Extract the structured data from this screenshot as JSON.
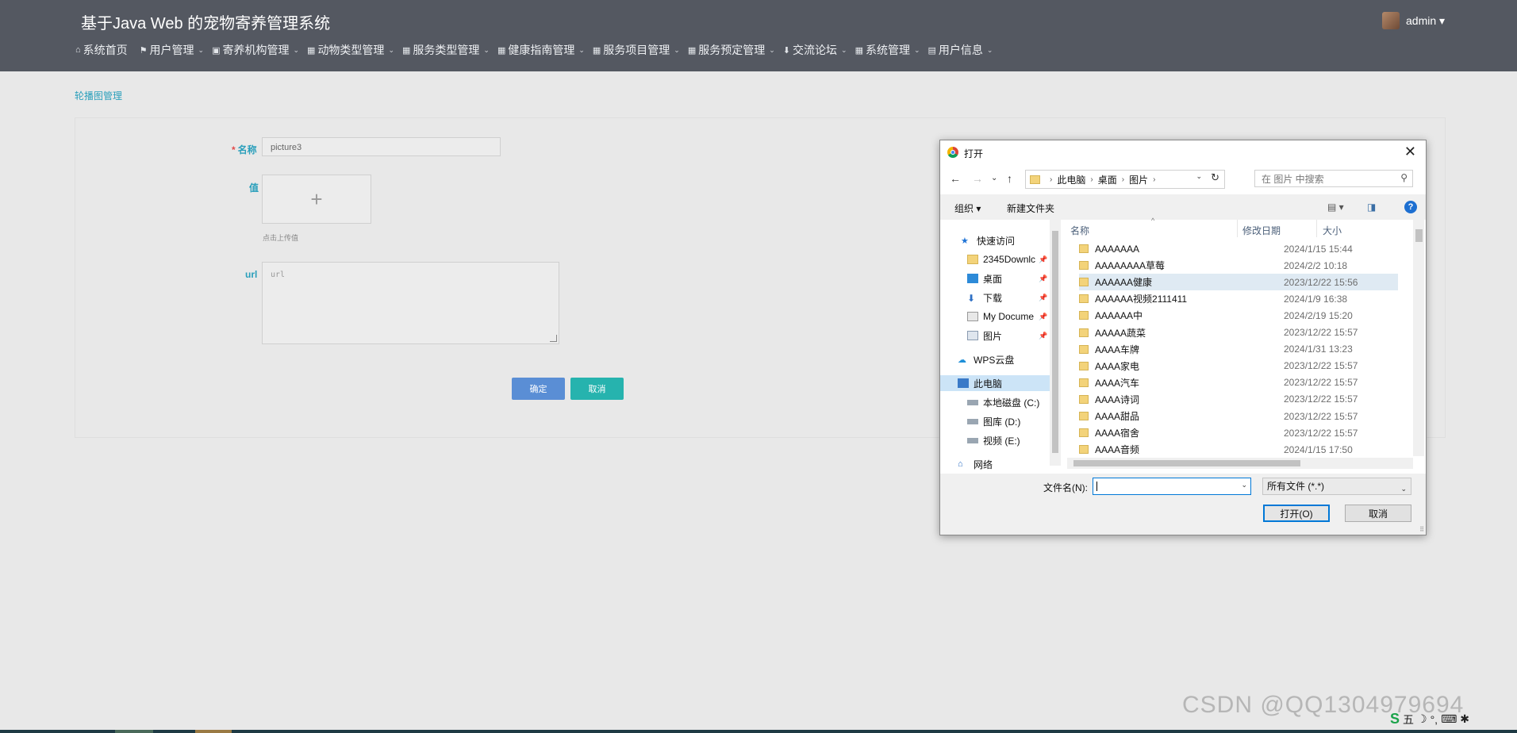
{
  "header": {
    "title": "基于Java Web 的宠物寄养管理系统",
    "user": "admin ▾",
    "nav": [
      {
        "icon": "⌂",
        "label": "系统首页",
        "caret": ""
      },
      {
        "icon": "⚑",
        "label": "用户管理",
        "caret": "⌄"
      },
      {
        "icon": "▣",
        "label": "寄养机构管理",
        "caret": "⌄"
      },
      {
        "icon": "▦",
        "label": "动物类型管理",
        "caret": "⌄"
      },
      {
        "icon": "▦",
        "label": "服务类型管理",
        "caret": "⌄"
      },
      {
        "icon": "▦",
        "label": "健康指南管理",
        "caret": "⌄"
      },
      {
        "icon": "▦",
        "label": "服务项目管理",
        "caret": "⌄"
      },
      {
        "icon": "▦",
        "label": "服务预定管理",
        "caret": "⌄"
      },
      {
        "icon": "⬇",
        "label": "交流论坛",
        "caret": "⌄"
      },
      {
        "icon": "▦",
        "label": "系统管理",
        "caret": "⌄"
      },
      {
        "icon": "▤",
        "label": "用户信息",
        "caret": "⌄"
      }
    ]
  },
  "page": {
    "section_title": "轮播图管理",
    "form": {
      "name_required": "*",
      "name_label": "名称",
      "name_value": "picture3",
      "value_label": "值",
      "upload_plus": "+",
      "upload_hint": "点击上传值",
      "url_label": "url",
      "url_placeholder": "url",
      "ok_label": "确定",
      "cancel_label": "取消"
    }
  },
  "dialog": {
    "title": "打开",
    "close": "✕",
    "back": "←",
    "forward": "→",
    "recent": "⌄",
    "up": "↑",
    "breadcrumb": [
      "此电脑",
      "桌面",
      "图片"
    ],
    "breadcrumb_sep": "›",
    "refresh": "↻",
    "search_placeholder": "在 图片 中搜索",
    "organize": "组织 ▾",
    "new_folder": "新建文件夹",
    "view": "▤ ▾",
    "help": "?",
    "columns": {
      "name": "名称",
      "date": "修改日期",
      "size": "大小"
    },
    "tree": [
      {
        "label": "快速访问",
        "pinned": false
      },
      {
        "label": "2345Downlc",
        "pinned": true
      },
      {
        "label": "桌面",
        "pinned": true
      },
      {
        "label": "下载",
        "pinned": true
      },
      {
        "label": "My Docume",
        "pinned": true
      },
      {
        "label": "图片",
        "pinned": true
      },
      {
        "label": "WPS云盘",
        "pinned": false
      },
      {
        "label": "此电脑",
        "pinned": false
      },
      {
        "label": "本地磁盘 (C:)",
        "pinned": false
      },
      {
        "label": "图库 (D:)",
        "pinned": false
      },
      {
        "label": "视频 (E:)",
        "pinned": false
      },
      {
        "label": "网络",
        "pinned": false
      }
    ],
    "pin_glyph": "📌",
    "files": [
      {
        "name": "AAAAAAA",
        "date": "2024/1/15 15:44"
      },
      {
        "name": "AAAAAAAA草莓",
        "date": "2024/2/2 10:18"
      },
      {
        "name": "AAAAAA健康",
        "date": "2023/12/22 15:56"
      },
      {
        "name": "AAAAAA视频2111411",
        "date": "2024/1/9 16:38"
      },
      {
        "name": "AAAAAA中",
        "date": "2024/2/19 15:20"
      },
      {
        "name": "AAAAA蔬菜",
        "date": "2023/12/22 15:57"
      },
      {
        "name": "AAAA车牌",
        "date": "2024/1/31 13:23"
      },
      {
        "name": "AAAA家电",
        "date": "2023/12/22 15:57"
      },
      {
        "name": "AAAA汽车",
        "date": "2023/12/22 15:57"
      },
      {
        "name": "AAAA诗词",
        "date": "2023/12/22 15:57"
      },
      {
        "name": "AAAA甜品",
        "date": "2023/12/22 15:57"
      },
      {
        "name": "AAAA宿舍",
        "date": "2023/12/22 15:57"
      },
      {
        "name": "AAAA音频",
        "date": "2024/1/15 17:50"
      }
    ],
    "filename_label": "文件名(N):",
    "filetype": "所有文件 (*.*)",
    "open_label": "打开(O)",
    "cancel_label": "取消"
  },
  "watermark": "CSDN @QQ1304979694",
  "tray": [
    "S",
    "五",
    "☽",
    "°,",
    "⌨",
    "✱"
  ]
}
